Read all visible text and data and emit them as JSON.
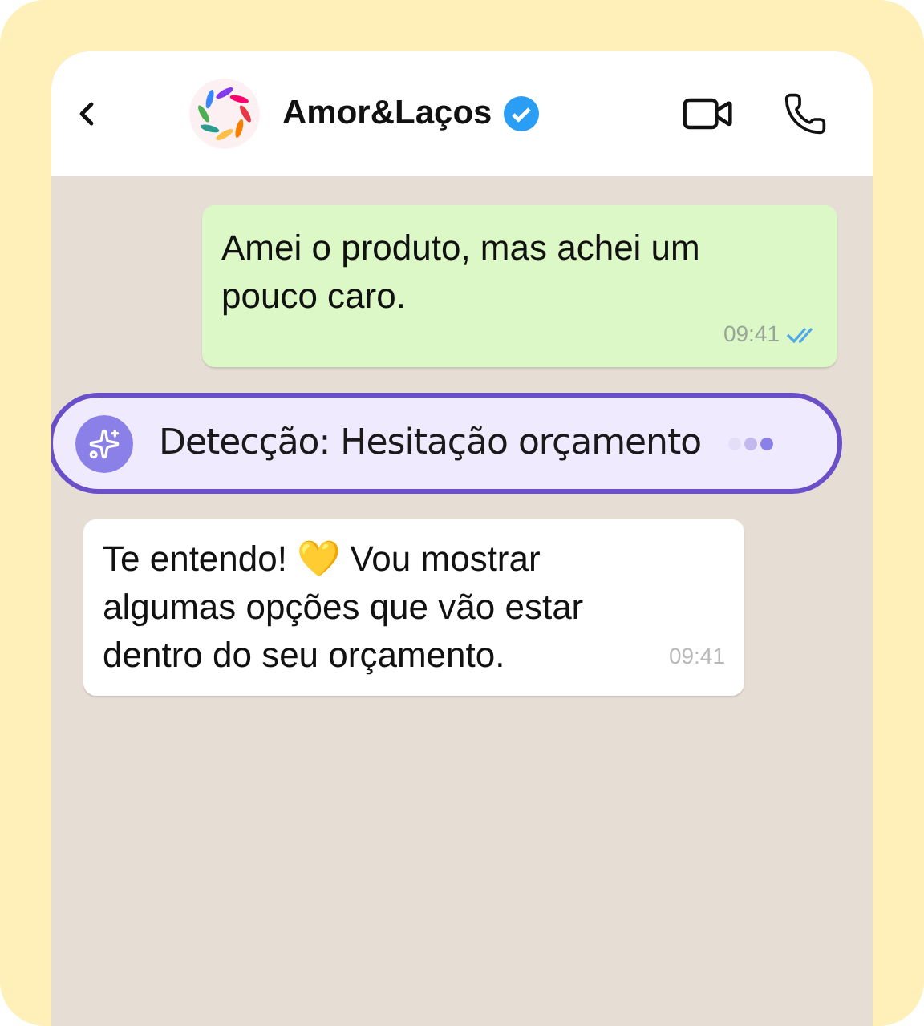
{
  "header": {
    "contact_name": "Amor&Laços",
    "verified": true
  },
  "messages": [
    {
      "kind": "outgoing",
      "text": "Amei o produto, mas achei um pouco caro.",
      "time": "09:41",
      "read": true
    },
    {
      "kind": "detection",
      "text": "Detecção: Hesitação orçamento"
    },
    {
      "kind": "incoming",
      "text": "Te entendo! 💛 Vou mostrar algumas opções que vão estar dentro do seu orçamento.",
      "time": "09:41"
    }
  ]
}
